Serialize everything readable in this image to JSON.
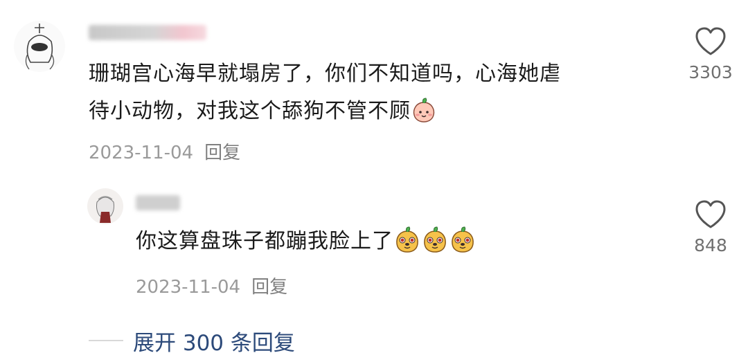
{
  "comments": [
    {
      "text_line1": "珊瑚宫心海早就塌房了，你们不知道吗，心海她虐",
      "text_line2": "待小动物，对我这个舔狗不管不顾",
      "date": "2023-11-04",
      "reply_label": "回复",
      "likes": "3303",
      "emoji": "peach-face"
    },
    {
      "text": "你这算盘珠子都蹦我脸上了",
      "date": "2023-11-04",
      "reply_label": "回复",
      "likes": "848",
      "emoji": "dog-face"
    }
  ],
  "expand": {
    "label": "展开 300 条回复"
  },
  "colors": {
    "text": "#1a1a1a",
    "meta": "#9a9a9a",
    "link": "#2c4a7a",
    "heart": "#555555"
  },
  "icons": [
    "heart-outline-icon",
    "peach-face-emoji",
    "dog-face-emoji"
  ]
}
